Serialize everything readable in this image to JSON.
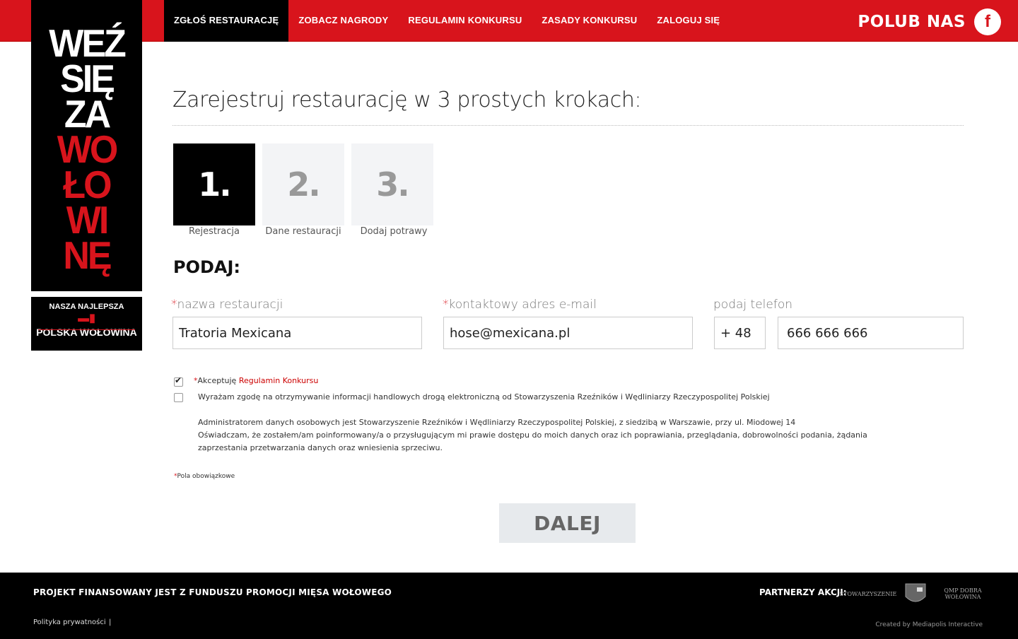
{
  "nav": {
    "items": [
      {
        "label": "ZGŁOŚ RESTAURACJĘ",
        "active": true
      },
      {
        "label": "ZOBACZ NAGRODY",
        "active": false
      },
      {
        "label": "REGULAMIN KONKURSU",
        "active": false
      },
      {
        "label": "ZASADY KONKURSU",
        "active": false
      },
      {
        "label": "ZALOGUJ SIĘ",
        "active": false
      }
    ],
    "like_us": "POLUB NAS",
    "facebook_glyph": "f"
  },
  "logo": {
    "lines": [
      {
        "text": "WEŹ",
        "color": "#ffffff"
      },
      {
        "text": "SIĘ",
        "color": "#ffffff"
      },
      {
        "text": "ZA",
        "color": "#ffffff"
      },
      {
        "text": "WO",
        "color": "#d8141c"
      },
      {
        "text": "ŁO",
        "color": "#d8141c"
      },
      {
        "text": "WI",
        "color": "#d8141c"
      },
      {
        "text": "NĘ",
        "color": "#d8141c"
      }
    ],
    "badge_top": "NASZA NAJLEPSZA",
    "badge_bottom": "POLSKA WOŁOWINA"
  },
  "page": {
    "title": "Zarejestruj restaurację w 3 prostych krokach:",
    "steps": [
      {
        "number": "1.",
        "label": "Rejestracja",
        "active": true
      },
      {
        "number": "2.",
        "label": "Dane restauracji",
        "active": false
      },
      {
        "number": "3.",
        "label": "Dodaj potrawy",
        "active": false
      }
    ],
    "section_heading": "PODAJ:"
  },
  "form": {
    "required_mark": "*",
    "name_label": "nazwa restauracji",
    "name_value": "Tratoria Mexicana",
    "email_label": "kontaktowy adres e-mail",
    "email_value": "hose@mexicana.pl",
    "phone_label": "podaj telefon",
    "phone_prefix": "+ 48",
    "phone_value": "666 666 666",
    "accept_text": "Akceptuję ",
    "accept_link": "Regulamin Konkursu",
    "accept_checked": true,
    "marketing_text": "Wyrażam zgodę na otrzymywanie informacji handlowych drogą elektroniczną od Stowarzyszenia Rzeźników i Wędliniarzy Rzeczypospolitej Polskiej",
    "marketing_checked": false,
    "admin_text": "Administratorem danych osobowych jest Stowarzyszenie Rzeźników i Wędliniarzy Rzeczypospolitej Polskiej, z siedzibą w Warszawie, przy ul. Miodowej 14",
    "statement_text": "Oświadczam, że zostałem/am poinformowany/a o przysługującym mi prawie dostępu do moich danych oraz ich poprawiania, przeglądania, dobrowolności podania, żądania zaprzestania przetwarzania danych oraz wniesienia sprzeciwu.",
    "required_note": "Pola obowiązkowe",
    "submit_label": "DALEJ"
  },
  "footer": {
    "funding": "PROJEKT FINANSOWANY JEST Z FUNDUSZU PROMOCJI MIĘSA WOŁOWEGO",
    "privacy": "Polityka prywatności",
    "separator": "|",
    "partners_label": "PARTNERZY AKCJI:",
    "partner_logos": [
      "STOWARZYSZENIE",
      "QMP DOBRA WOŁOWINA"
    ],
    "created_by": "Created by Mediapolis Interactive"
  },
  "colors": {
    "brand_red": "#d8141c",
    "black": "#000000",
    "step_inactive": "#f3f4f6"
  }
}
